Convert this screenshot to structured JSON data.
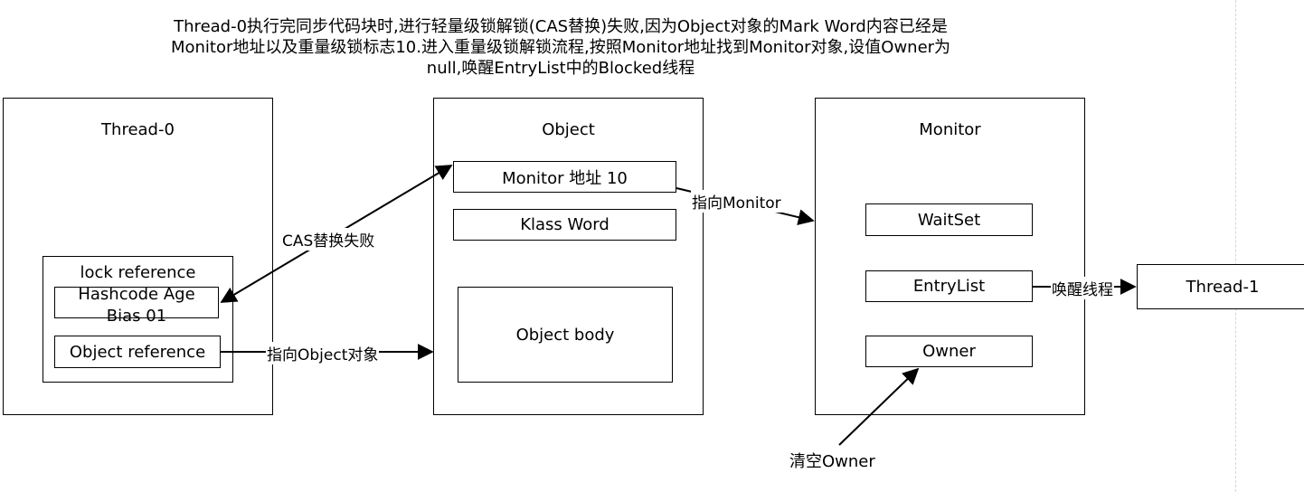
{
  "description": {
    "line1": "Thread-0执行完同步代码块时,进行轻量级锁解锁(CAS替换)失败,因为Object对象的Mark Word内容已经是",
    "line2": "Monitor地址以及重量级锁标志10.进入重量级锁解锁流程,按照Monitor地址找到Monitor对象,设值Owner为",
    "line3": "null,唤醒EntryList中的Blocked线程"
  },
  "thread0": {
    "title": "Thread-0",
    "lock_record": {
      "title": "lock reference",
      "hashcode": "Hashcode  Age",
      "bias": "Bias 01",
      "object_reference": "Object reference"
    }
  },
  "object": {
    "title": "Object",
    "mark_word": "Monitor 地址 10",
    "klass_word": "Klass Word",
    "body": "Object body"
  },
  "monitor": {
    "title": "Monitor",
    "waitset": "WaitSet",
    "entrylist": "EntryList",
    "owner": "Owner"
  },
  "thread1": {
    "title": "Thread-1"
  },
  "edges": {
    "cas_fail": "CAS替换失败",
    "point_object": "指向Object对象",
    "point_monitor": "指向Monitor",
    "wake_thread": "唤醒线程",
    "clear_owner": "清空Owner"
  }
}
